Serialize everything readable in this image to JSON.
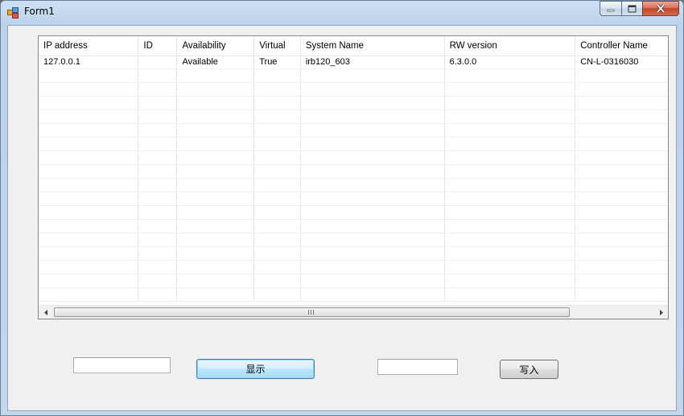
{
  "window": {
    "title": "Form1",
    "icon": "winforms-app-icon",
    "buttons": [
      "minimize-icon",
      "maximize-icon",
      "close-icon"
    ]
  },
  "grid": {
    "columns": [
      "IP address",
      "ID",
      "Availability",
      "Virtual",
      "System Name",
      "RW version",
      "Controller Name"
    ],
    "rows": [
      [
        "127.0.0.1",
        "",
        "Available",
        "True",
        "irb120_603",
        "6.3.0.0",
        "CN-L-0316030"
      ]
    ],
    "scroll_grip": "III"
  },
  "controls": {
    "textbox1_value": "",
    "show_button_label": "显示",
    "textbox2_value": "",
    "write_button_label": "写入"
  },
  "colors": {
    "accent_button_border": "#3c7fb1",
    "close_button": "#c4452a"
  }
}
